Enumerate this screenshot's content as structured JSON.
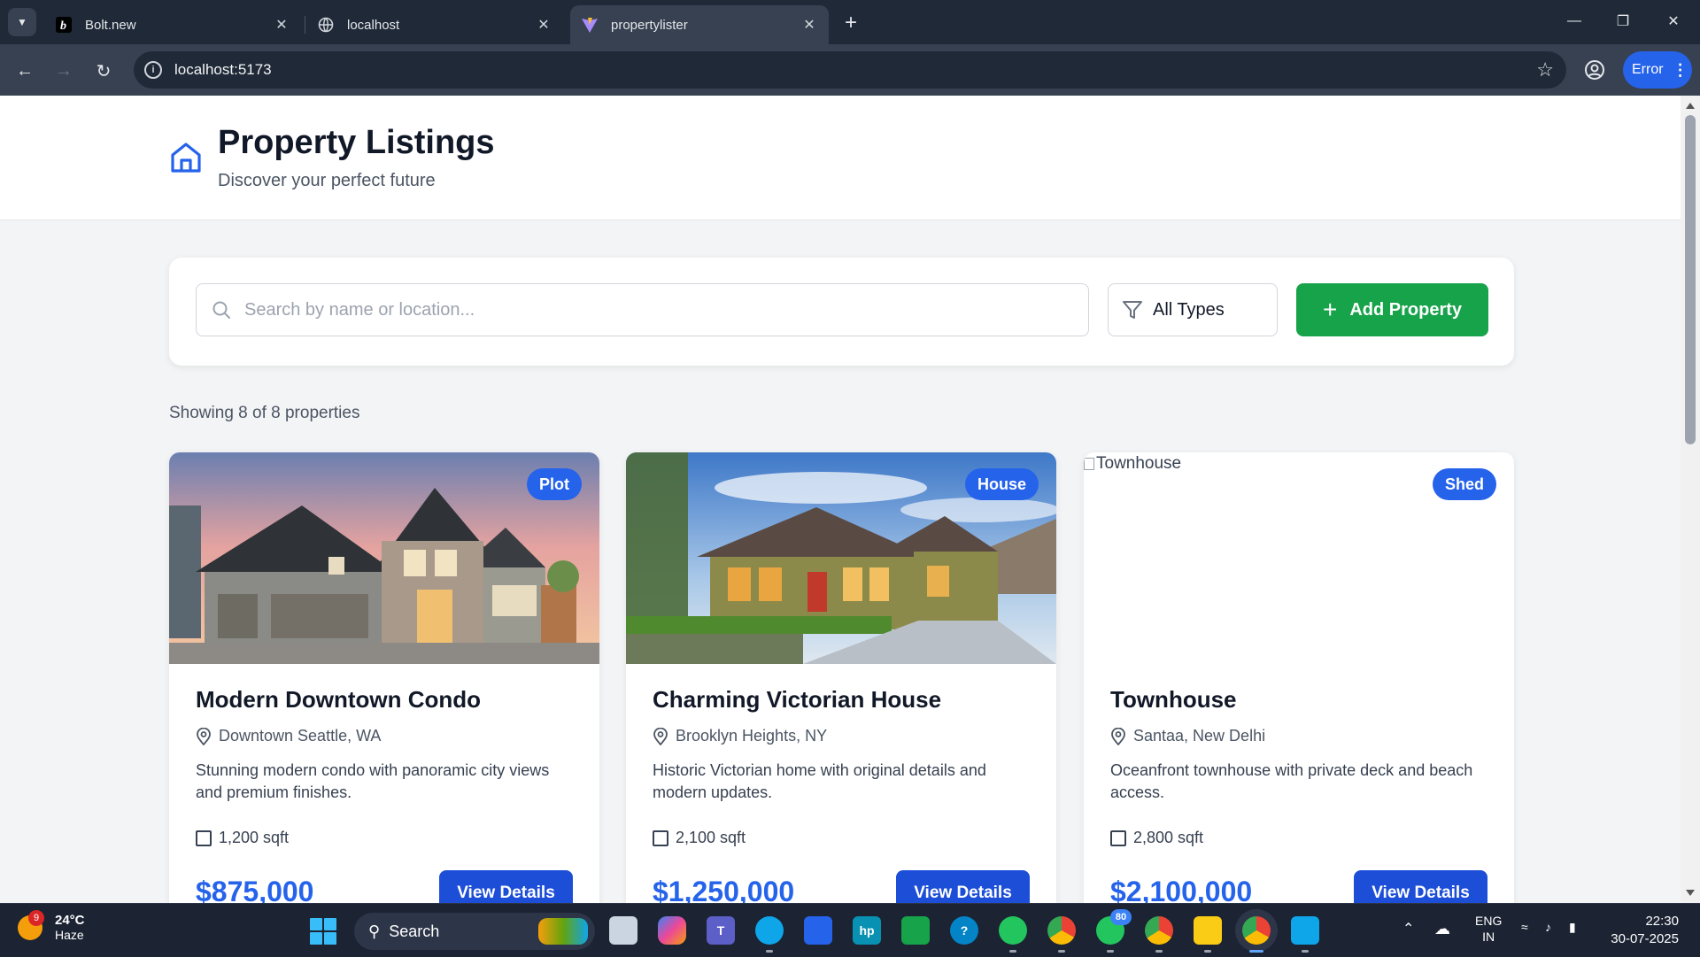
{
  "browser": {
    "tabs": [
      {
        "title": "Bolt.new",
        "icon": "bolt-favicon-icon"
      },
      {
        "title": "localhost",
        "icon": "globe-icon"
      },
      {
        "title": "propertylister",
        "icon": "vite-favicon-icon",
        "active": true
      }
    ],
    "url": "localhost:5173",
    "error_label": "Error"
  },
  "header": {
    "title": "Property Listings",
    "subtitle": "Discover your perfect future"
  },
  "filters": {
    "search_placeholder": "Search by name or location...",
    "type_selected": "All Types",
    "add_label": "Add Property"
  },
  "results": {
    "count_text": "Showing 8 of 8 properties"
  },
  "properties": [
    {
      "type": "Plot",
      "name": "Modern Downtown Condo",
      "location": "Downtown Seattle, WA",
      "description": "Stunning modern condo with panoramic city views and premium finishes.",
      "area": "1,200 sqft",
      "price": "$875,000",
      "button": "View Details"
    },
    {
      "type": "House",
      "name": "Charming Victorian House",
      "location": "Brooklyn Heights, NY",
      "description": "Historic Victorian home with original details and modern updates.",
      "area": "2,100 sqft",
      "price": "$1,250,000",
      "button": "View Details"
    },
    {
      "type": "Shed",
      "name": "Townhouse",
      "image_alt": "Townhouse",
      "location": "Santaa, New Delhi",
      "description": "Oceanfront townhouse with private deck and beach access.",
      "area": "2,800 sqft",
      "price": "$2,100,000",
      "button": "View Details"
    }
  ],
  "taskbar": {
    "weather_temp": "24°C",
    "weather_desc": "Haze",
    "weather_badge": "9",
    "search_label": "Search",
    "whatsapp_badge": "80",
    "lang_top": "ENG",
    "lang_bottom": "IN",
    "time": "22:30",
    "date": "30-07-2025"
  },
  "colors": {
    "primary": "#2563eb",
    "add_button": "#16a34a",
    "chrome_dark": "#1f2937"
  }
}
